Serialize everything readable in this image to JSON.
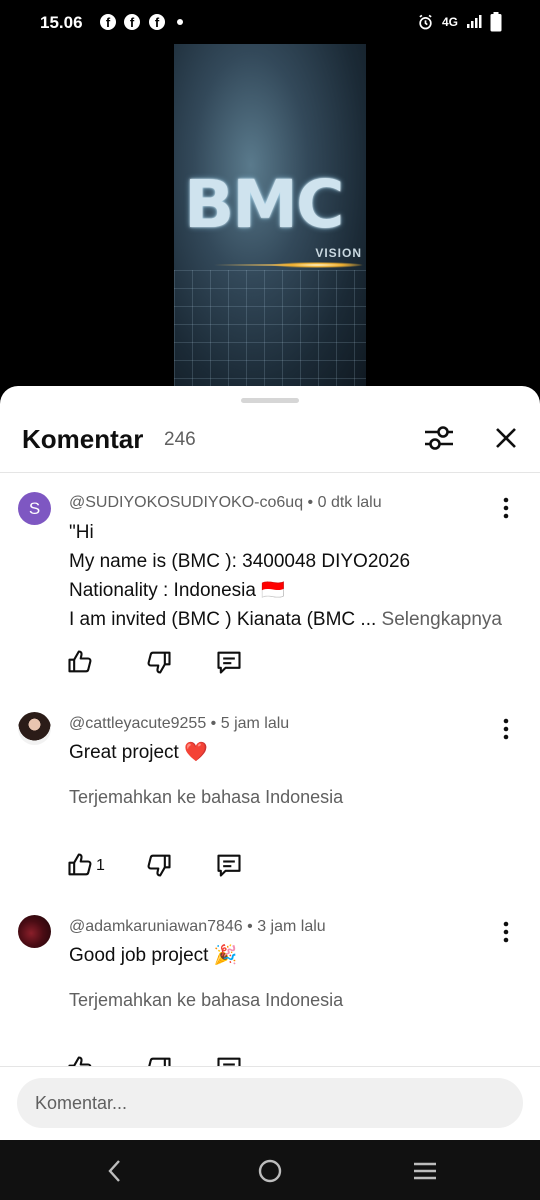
{
  "status_bar": {
    "time": "15.06",
    "app_icons": [
      "facebook-icon",
      "facebook-icon",
      "facebook-icon"
    ],
    "network": "4G"
  },
  "video": {
    "logo_text": "BMC",
    "sub_text": "VISION"
  },
  "comments_panel": {
    "title": "Komentar",
    "count": "246",
    "comments": [
      {
        "author": "@SUDIYOKOSUDIYOKO-co6uq",
        "time": "0 dtk lalu",
        "avatar_letter": "S",
        "lines": [
          "\"Hi",
          "My name is (BMC ): 3400048 DIYO2026",
          "Nationality : Indonesia 🇮🇩",
          "I am invited (BMC ) Kianata (BMC ..."
        ],
        "more_label": "Selengkapnya",
        "likes": ""
      },
      {
        "author": "@cattleyacute9255",
        "time": "5 jam lalu",
        "text": "Great project ❤️",
        "translate_label": "Terjemahkan ke bahasa Indonesia",
        "likes": "1"
      },
      {
        "author": "@adamkaruniawan7846",
        "time": "3 jam lalu",
        "text": "Good job project 🎉",
        "translate_label": "Terjemahkan ke bahasa Indonesia",
        "likes": ""
      }
    ],
    "meta_separator": " • "
  },
  "input": {
    "placeholder": "Komentar..."
  },
  "colors": {
    "avatar_s": "#7e57c2",
    "text_primary": "#0f0f0f",
    "text_secondary": "#606060",
    "sheet_bg": "#ffffff",
    "input_bg": "#f0f0f0"
  }
}
